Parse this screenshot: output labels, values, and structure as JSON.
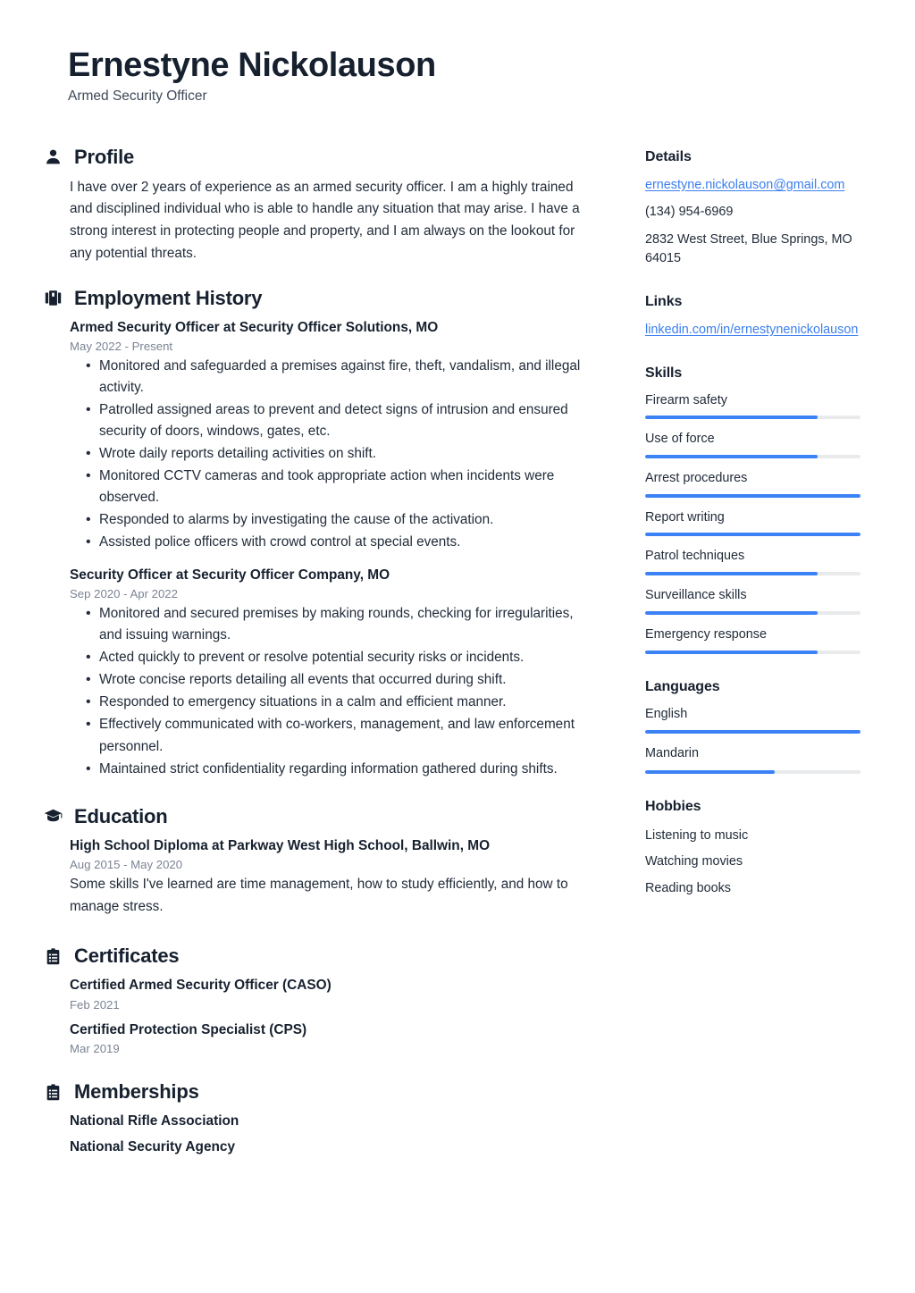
{
  "header": {
    "name": "Ernestyne Nickolauson",
    "title": "Armed Security Officer"
  },
  "colors": {
    "accent": "#3b82f6",
    "link": "#3b7ff0",
    "heading": "#16202e",
    "body_text": "#222c3a",
    "muted_date": "#7b8493",
    "meter_track": "#e9eaec"
  },
  "main": {
    "profile": {
      "icon": "person-icon",
      "title": "Profile",
      "text": "I have over 2 years of experience as an armed security officer. I am a highly trained and disciplined individual who is able to handle any situation that may arise. I have a strong interest in protecting people and property, and I am always on the lookout for any potential threats."
    },
    "employment": {
      "icon": "briefcase-icon",
      "title": "Employment History",
      "entries": [
        {
          "title": "Armed Security Officer at Security Officer Solutions, MO",
          "date": "May 2022 - Present",
          "bullets": [
            "Monitored and safeguarded a premises against fire, theft, vandalism, and illegal activity.",
            "Patrolled assigned areas to prevent and detect signs of intrusion and ensured security of doors, windows, gates, etc.",
            "Wrote daily reports detailing activities on shift.",
            "Monitored CCTV cameras and took appropriate action when incidents were observed.",
            "Responded to alarms by investigating the cause of the activation.",
            "Assisted police officers with crowd control at special events."
          ]
        },
        {
          "title": "Security Officer at Security Officer Company, MO",
          "date": "Sep 2020 - Apr 2022",
          "bullets": [
            "Monitored and secured premises by making rounds, checking for irregularities, and issuing warnings.",
            "Acted quickly to prevent or resolve potential security risks or incidents.",
            "Wrote concise reports detailing all events that occurred during shift.",
            "Responded to emergency situations in a calm and efficient manner.",
            "Effectively communicated with co-workers, management, and law enforcement personnel.",
            "Maintained strict confidentiality regarding information gathered during shifts."
          ]
        }
      ]
    },
    "education": {
      "icon": "graduation-cap-icon",
      "title": "Education",
      "entries": [
        {
          "title": "High School Diploma at Parkway West High School, Ballwin, MO",
          "date": "Aug 2015 - May 2020",
          "description": "Some skills I've learned are time management, how to study efficiently, and how to manage stress."
        }
      ]
    },
    "certificates": {
      "icon": "clipboard-icon",
      "title": "Certificates",
      "entries": [
        {
          "title": "Certified Armed Security Officer (CASO)",
          "date": "Feb 2021"
        },
        {
          "title": "Certified Protection Specialist (CPS)",
          "date": "Mar 2019"
        }
      ]
    },
    "memberships": {
      "icon": "clipboard-icon",
      "title": "Memberships",
      "entries": [
        {
          "title": "National Rifle Association"
        },
        {
          "title": "National Security Agency"
        }
      ]
    }
  },
  "sidebar": {
    "details": {
      "title": "Details",
      "email": "ernestyne.nickolauson@gmail.com",
      "phone": "(134) 954-6969",
      "address": "2832 West Street, Blue Springs, MO 64015"
    },
    "links": {
      "title": "Links",
      "items": [
        {
          "label": "linkedin.com/in/ernestynenickolauson"
        }
      ]
    },
    "skills": {
      "title": "Skills",
      "items": [
        {
          "label": "Firearm safety",
          "level": 80
        },
        {
          "label": "Use of force",
          "level": 80
        },
        {
          "label": "Arrest procedures",
          "level": 100
        },
        {
          "label": "Report writing",
          "level": 100
        },
        {
          "label": "Patrol techniques",
          "level": 80
        },
        {
          "label": "Surveillance skills",
          "level": 80
        },
        {
          "label": "Emergency response",
          "level": 80
        }
      ]
    },
    "languages": {
      "title": "Languages",
      "items": [
        {
          "label": "English",
          "level": 100
        },
        {
          "label": "Mandarin",
          "level": 60
        }
      ]
    },
    "hobbies": {
      "title": "Hobbies",
      "items": [
        {
          "label": "Listening to music"
        },
        {
          "label": "Watching movies"
        },
        {
          "label": "Reading books"
        }
      ]
    }
  }
}
